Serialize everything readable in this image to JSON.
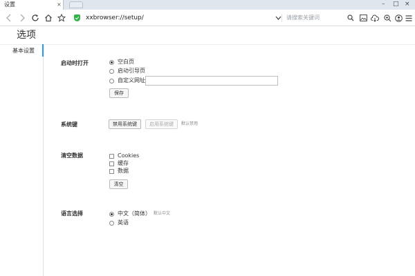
{
  "tab": {
    "title": "设置",
    "close": "×"
  },
  "window": {
    "minimize": "–",
    "maximize": "□",
    "close": "×"
  },
  "toolbar": {
    "url": "xxbrowser://setup/",
    "search_placeholder": "请搜索关键词",
    "icons": [
      "back-icon",
      "forward-icon",
      "reload-icon",
      "home-icon",
      "star-icon",
      "shield-icon",
      "dropdown-icon",
      "search-icon",
      "image-icon",
      "download-icon",
      "zoom-icon",
      "user-icon",
      "menu-icon"
    ]
  },
  "page": {
    "title": "选项"
  },
  "sidebar": {
    "items": [
      {
        "label": "基本设置"
      }
    ]
  },
  "startup": {
    "label": "启动时打开",
    "options": [
      "空白页",
      "启动引导页",
      "自定义网址"
    ],
    "selected": 0,
    "url_value": "",
    "save_label": "保存"
  },
  "syskey": {
    "label": "系统键",
    "disable_label": "禁用系统键",
    "enable_label": "启用系统键",
    "hint": "默认禁用"
  },
  "clear": {
    "label": "清空数据",
    "items": [
      "Cookies",
      "缓存",
      "数据"
    ],
    "button_label": "清空"
  },
  "language": {
    "label": "语言选择",
    "options": [
      "中文（简体）",
      "英语"
    ],
    "selected": 0,
    "hint": "默认中文"
  },
  "colors": {
    "accent": "#2196f3",
    "shield": "#33b24a"
  }
}
